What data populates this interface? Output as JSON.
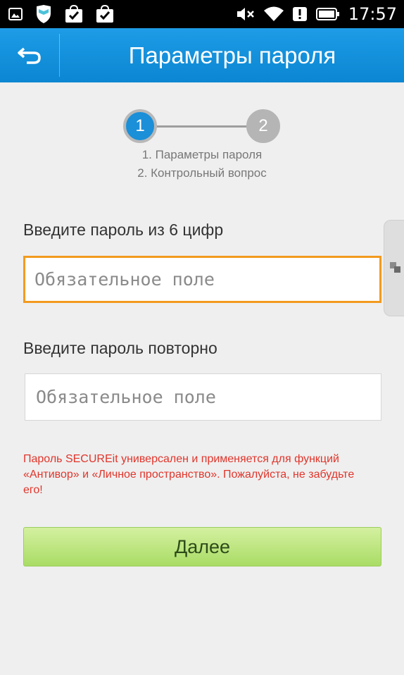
{
  "status_bar": {
    "time": "17:57",
    "icons_left": [
      "image-icon",
      "shield-icon",
      "shopping-check-icon",
      "shopping-check-icon"
    ],
    "icons_right": [
      "mute-icon",
      "wifi-icon",
      "alert-icon",
      "battery-icon"
    ]
  },
  "header": {
    "title": "Параметры пароля",
    "back_icon": "back-arrow-icon"
  },
  "stepper": {
    "steps": [
      {
        "number": "1",
        "label": "1. Параметры пароля"
      },
      {
        "number": "2",
        "label": "2. Контрольный вопрос"
      }
    ],
    "active_step": 1
  },
  "form": {
    "password_label": "Введите пароль из 6 цифр",
    "password_placeholder": "Обязательное поле",
    "password_value": "",
    "confirm_label": "Введите пароль повторно",
    "confirm_placeholder": "Обязательное поле",
    "confirm_value": ""
  },
  "warning": "Пароль SECUREit универсален и применяется для функций «Антивор» и «Личное пространство». Пожалуйста, не забудьте его!",
  "next_button": "Далее",
  "colors": {
    "header": "#1e9ce6",
    "active_step": "#1b8fd8",
    "focus_border": "#f39a1f",
    "warning_text": "#e0352b",
    "button_green": "#a9dc65"
  }
}
